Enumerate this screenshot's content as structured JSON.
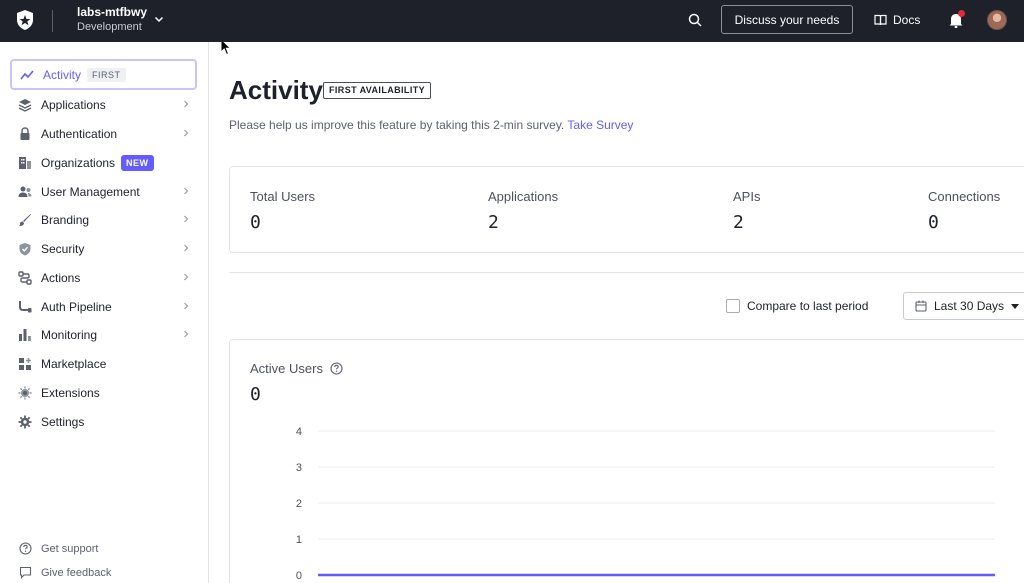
{
  "header": {
    "tenant_name": "labs-mtfbwy",
    "tenant_env": "Development",
    "discuss_label": "Discuss your needs",
    "docs_label": "Docs",
    "icons": [
      "auth0-logo-icon",
      "chevron-down-icon",
      "search-icon",
      "book-icon",
      "bell-icon",
      "avatar"
    ],
    "colors": {
      "bar": "#1e212a",
      "accent": "#635dff",
      "notification": "#e5283a"
    }
  },
  "sidebar": {
    "items": [
      {
        "label": "Activity",
        "icon": "chart-line-icon",
        "badge": "FIRST",
        "active": true,
        "chevron": false
      },
      {
        "label": "Applications",
        "icon": "layers-icon",
        "chevron": true
      },
      {
        "label": "Authentication",
        "icon": "lock-icon",
        "chevron": true
      },
      {
        "label": "Organizations",
        "icon": "building-icon",
        "badge": "NEW",
        "chevron": false
      },
      {
        "label": "User Management",
        "icon": "users-icon",
        "chevron": true
      },
      {
        "label": "Branding",
        "icon": "brush-icon",
        "chevron": true
      },
      {
        "label": "Security",
        "icon": "shield-icon",
        "chevron": true
      },
      {
        "label": "Actions",
        "icon": "flow-icon",
        "chevron": true
      },
      {
        "label": "Auth Pipeline",
        "icon": "pipeline-icon",
        "chevron": true
      },
      {
        "label": "Monitoring",
        "icon": "bar-chart-icon",
        "chevron": true
      },
      {
        "label": "Marketplace",
        "icon": "grid-plus-icon",
        "chevron": false
      },
      {
        "label": "Extensions",
        "icon": "puzzle-icon",
        "chevron": false
      },
      {
        "label": "Settings",
        "icon": "gear-icon",
        "chevron": false
      }
    ],
    "footer": {
      "support_label": "Get support",
      "feedback_label": "Give feedback"
    }
  },
  "main": {
    "title": "Activity",
    "title_badge": "FIRST AVAILABILITY",
    "survey_text": "Please help us improve this feature by taking this 2-min survey.",
    "survey_link": "Take Survey",
    "stats": [
      {
        "label": "Total Users",
        "value": "0"
      },
      {
        "label": "Applications",
        "value": "2"
      },
      {
        "label": "APIs",
        "value": "2"
      },
      {
        "label": "Connections",
        "value": "0"
      }
    ],
    "compare_label": "Compare to last period",
    "compare_checked": false,
    "range_label": "Last 30 Days"
  },
  "chart_data": {
    "type": "line",
    "title": "Active Users",
    "value": "0",
    "y_ticks": [
      "4",
      "3",
      "2",
      "1",
      "0"
    ],
    "ylim": [
      0,
      4
    ],
    "grid": true,
    "series": [
      {
        "values": [
          0,
          0
        ],
        "color": "#635dff"
      }
    ]
  }
}
